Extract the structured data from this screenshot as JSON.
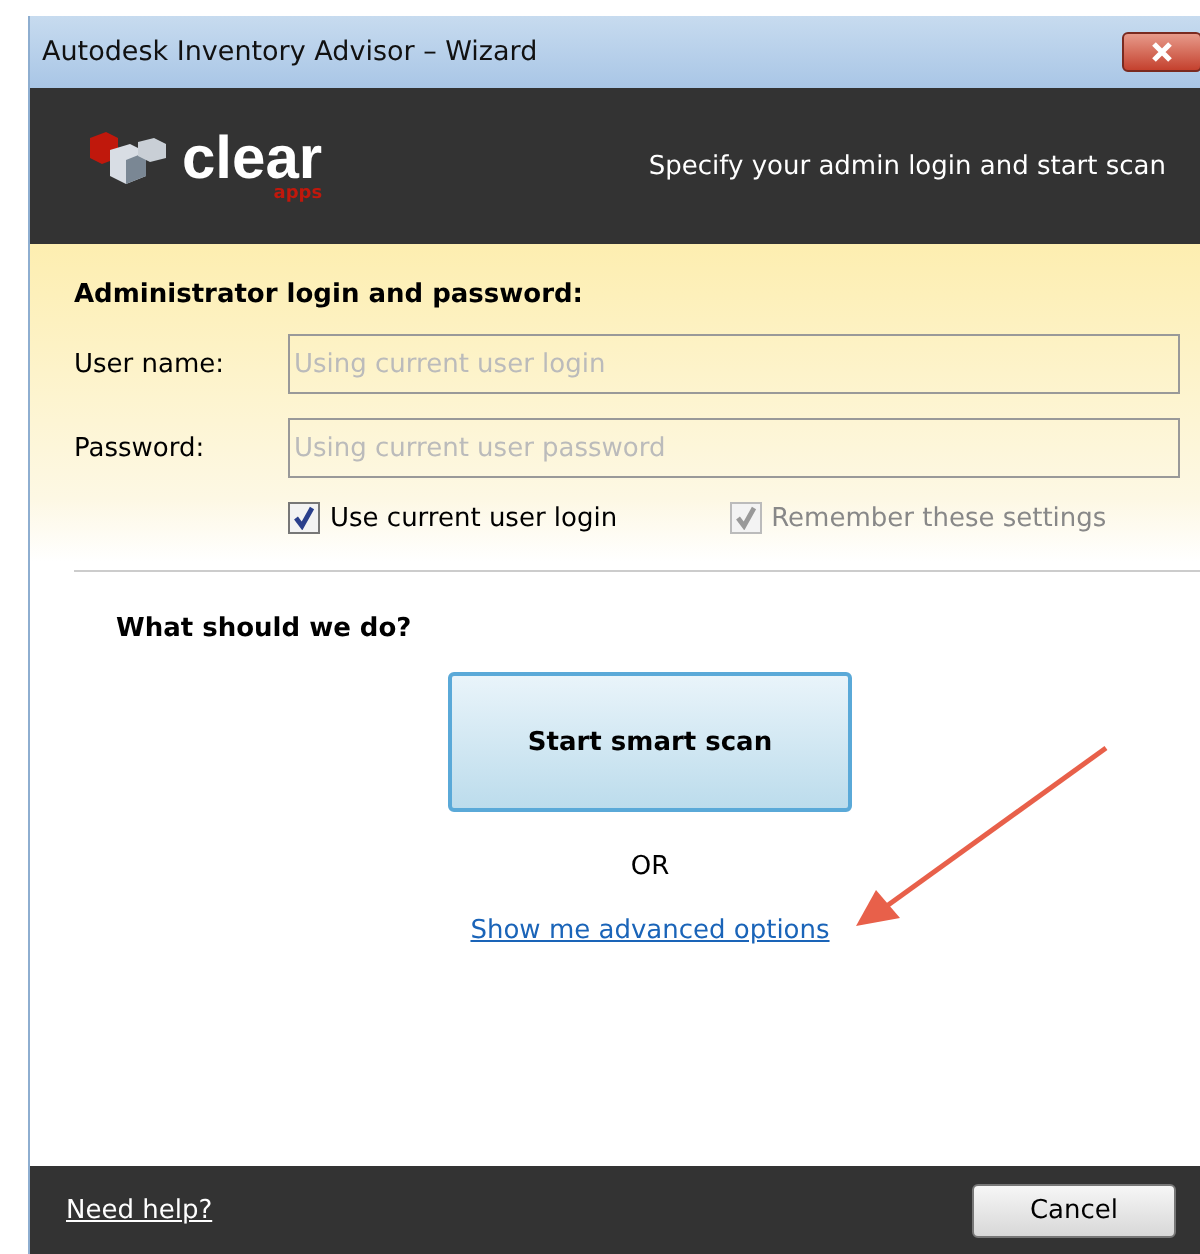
{
  "window": {
    "title": "Autodesk Inventory Advisor – Wizard"
  },
  "header": {
    "logo_text": "clear",
    "logo_subtext": "apps",
    "subtitle": "Specify your admin login and start scan"
  },
  "login": {
    "heading": "Administrator login and password:",
    "fields": [
      {
        "label": "User name:",
        "placeholder": "Using current user login",
        "disabled": true
      },
      {
        "label": "Password:",
        "placeholder": "Using current user password",
        "disabled": true
      }
    ],
    "checkboxes": [
      {
        "label": "Use current user login",
        "checked": true,
        "disabled": false
      },
      {
        "label": "Remember these settings",
        "checked": true,
        "disabled": true
      }
    ]
  },
  "action": {
    "question": "What should we do?",
    "primary_button": "Start smart scan",
    "separator": "OR",
    "link": "Show me advanced options"
  },
  "footer": {
    "help_link": "Need help?",
    "cancel_button": "Cancel"
  }
}
